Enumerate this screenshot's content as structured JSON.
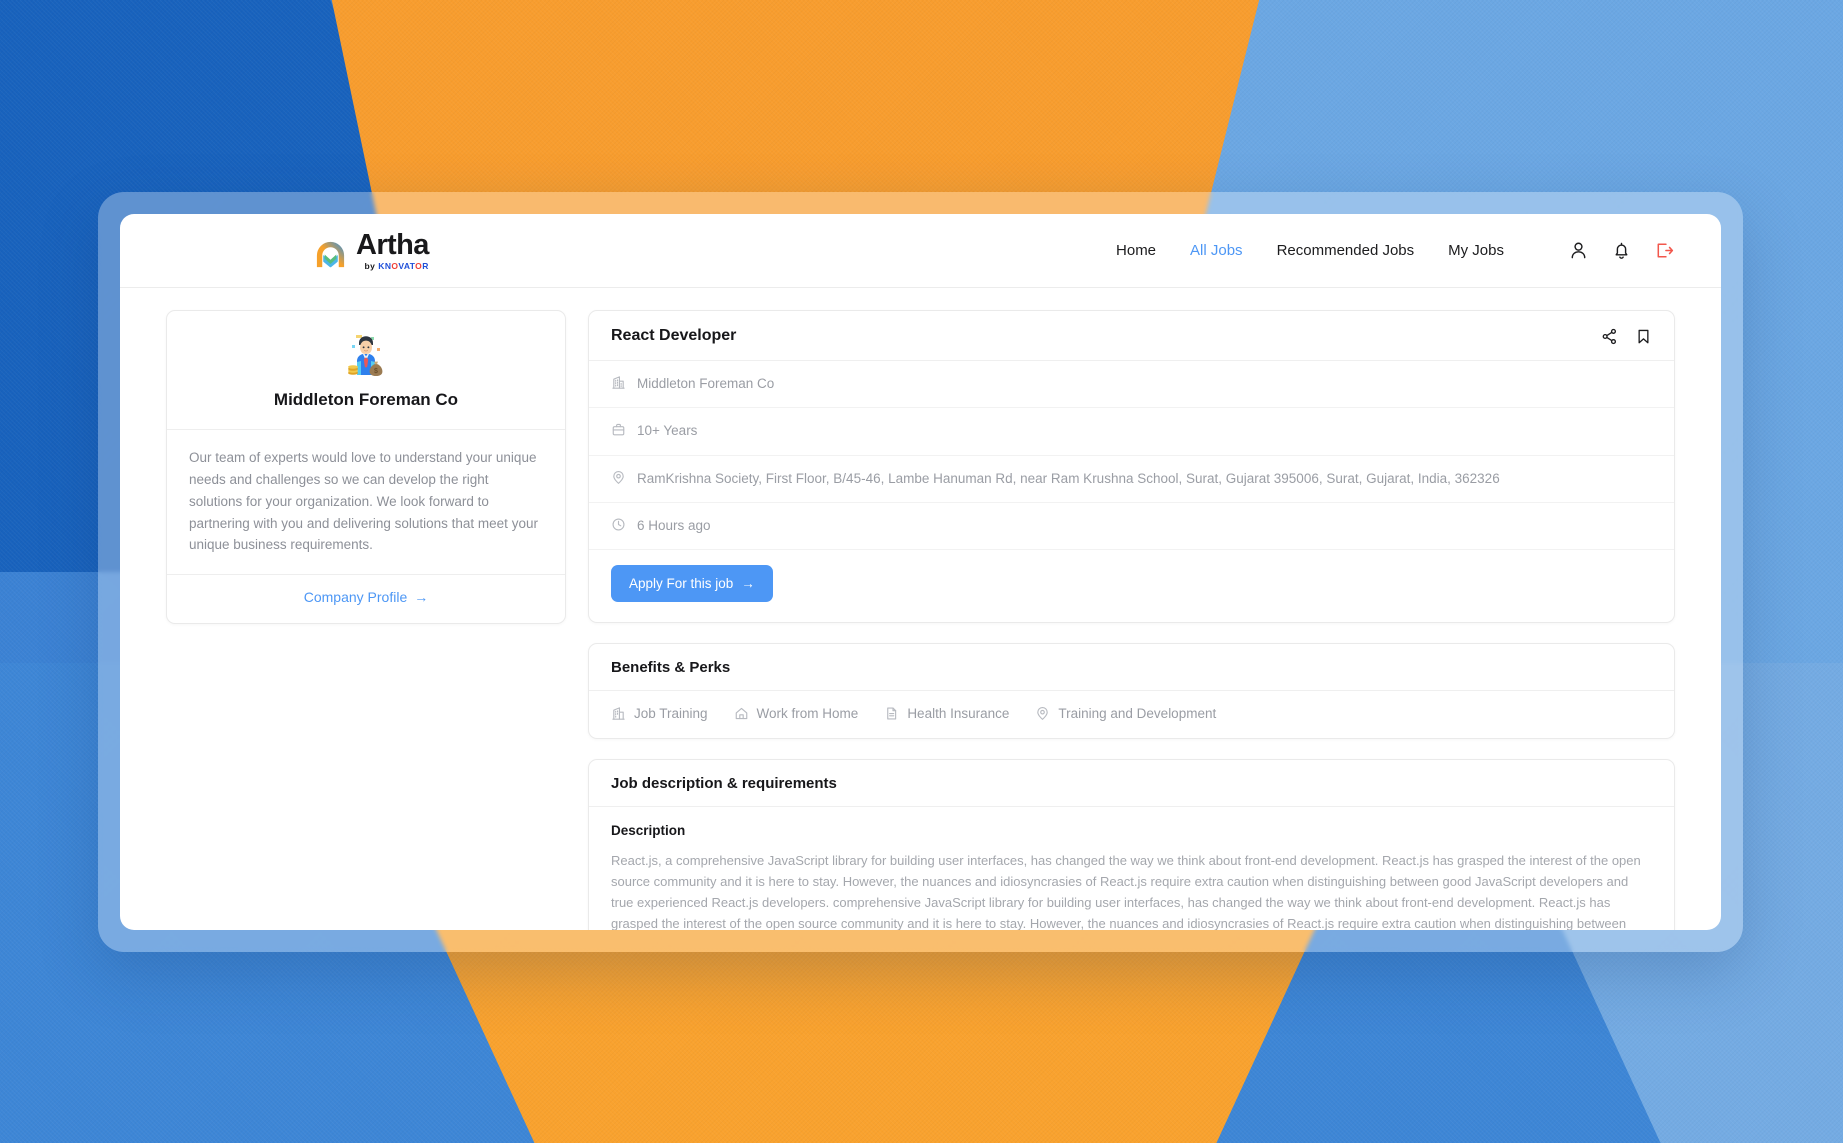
{
  "brand": {
    "name": "Artha",
    "by": "by",
    "parent": "KNOVATOR",
    "logo_icon": "artha-arch-logo"
  },
  "nav": {
    "links": [
      {
        "label": "Home",
        "active": false
      },
      {
        "label": "All Jobs",
        "active": true
      },
      {
        "label": "Recommended Jobs",
        "active": false
      },
      {
        "label": "My Jobs",
        "active": false
      }
    ],
    "icons": [
      {
        "name": "user-icon",
        "color": "#1c1c1e"
      },
      {
        "name": "bell-icon",
        "color": "#1c1c1e"
      },
      {
        "name": "logout-icon",
        "color": "#f2574c"
      }
    ],
    "active_color": "#4d97f5"
  },
  "company_card": {
    "avatar_icon": "businessman-with-money-illustration",
    "name": "Middleton Foreman Co",
    "description": "Our team of experts would love to understand your unique needs and challenges so we can develop the right solutions for your organization. We look forward to partnering with you and delivering solutions that meet your unique business requirements.",
    "profile_link": "Company Profile",
    "profile_link_arrow": "→"
  },
  "job": {
    "title": "React Developer",
    "share_icon": "share-icon",
    "bookmark_icon": "bookmark-icon",
    "meta": [
      {
        "icon": "building-icon",
        "text": "Middleton Foreman Co"
      },
      {
        "icon": "briefcase-icon",
        "text": "10+ Years"
      },
      {
        "icon": "location-pin-icon",
        "text": "RamKrishna Society, First Floor, B/45-46, Lambe Hanuman Rd, near Ram Krushna School, Surat, Gujarat 395006, Surat, Gujarat, India, 362326"
      },
      {
        "icon": "clock-icon",
        "text": "6 Hours ago"
      }
    ],
    "apply_label": "Apply For this job",
    "apply_arrow": "→",
    "apply_color": "#4d97f5"
  },
  "benefits": {
    "title": "Benefits & Perks",
    "items": [
      {
        "icon": "building-icon",
        "label": "Job Training"
      },
      {
        "icon": "home-icon",
        "label": "Work from Home"
      },
      {
        "icon": "document-icon",
        "label": "Health Insurance"
      },
      {
        "icon": "location-pin-icon",
        "label": "Training and Development"
      }
    ]
  },
  "description": {
    "title": "Job description & requirements",
    "subtitle": "Description",
    "body": "React.js, a comprehensive JavaScript library for building user interfaces, has changed the way we think about front-end development. React.js has grasped the interest of the open source community and it is here to stay. However, the nuances and idiosyncrasies of React.js require extra caution when distinguishing between good JavaScript developers and true experienced React.js developers. comprehensive JavaScript library for building user interfaces, has changed the way we think about front-end development. React.js has grasped the interest of the open source community and it is here to stay. However, the nuances and idiosyncrasies of React.js require extra caution when distinguishing between good JavaScript developers and true experienced React.js developers."
  },
  "theme": {
    "background_blue_dark": "#1862bd",
    "background_blue_mid": "#3d86d6",
    "background_blue_light": "#6ba7e3",
    "background_orange": "#f89d2e",
    "accent": "#4d97f5",
    "logout_red": "#f2574c"
  }
}
